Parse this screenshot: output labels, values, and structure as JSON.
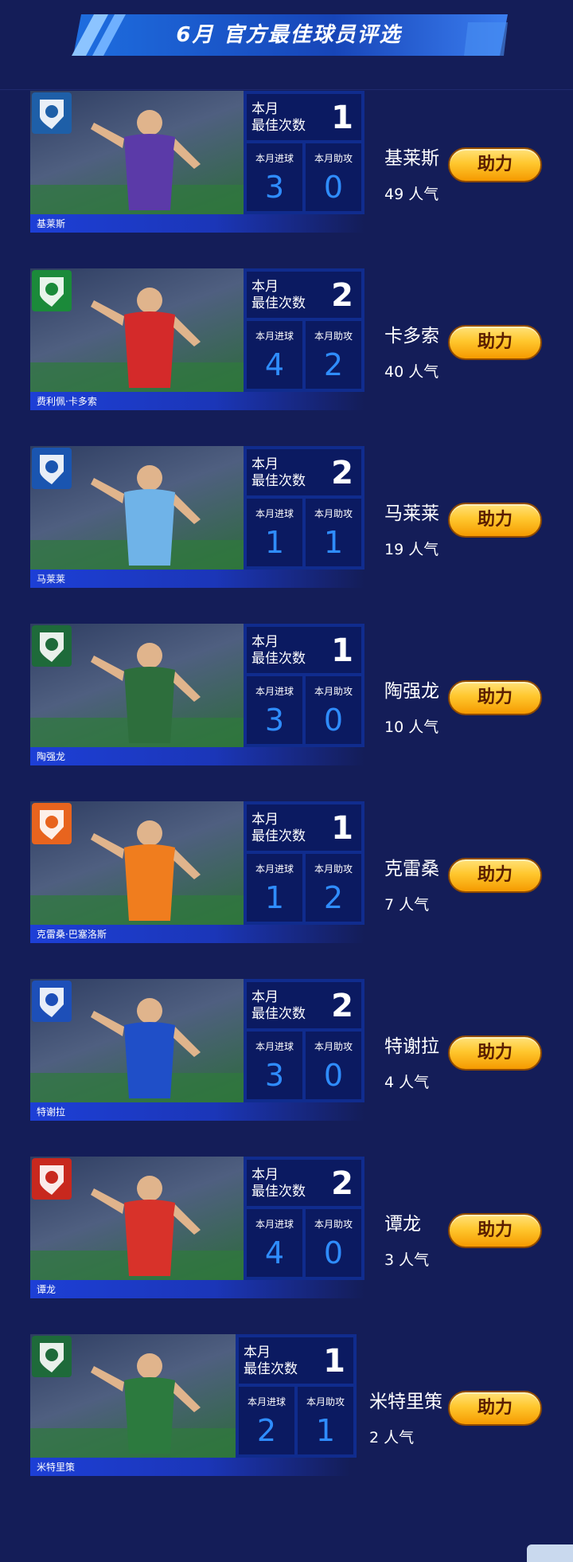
{
  "banner": {
    "title": "6月 官方最佳球员评选"
  },
  "labels": {
    "best_count": "本月\n最佳次数",
    "goals": "本月进球",
    "assists": "本月助攻",
    "boost": "助力"
  },
  "players": [
    {
      "short_name": "基莱斯",
      "full_name": "基莱斯",
      "best_times": "1",
      "goals": "3",
      "assists": "0",
      "popularity": "49 人气",
      "jersey_color": "#5b3aa8",
      "club_badge_color": "#1e5fa8"
    },
    {
      "short_name": "卡多索",
      "full_name": "费利佩·卡多索",
      "best_times": "2",
      "goals": "4",
      "assists": "2",
      "popularity": "40 人气",
      "jersey_color": "#d42a2a",
      "club_badge_color": "#1b8a3a"
    },
    {
      "short_name": "马莱莱",
      "full_name": "马莱莱",
      "best_times": "2",
      "goals": "1",
      "assists": "1",
      "popularity": "19 人气",
      "jersey_color": "#6fb3e8",
      "club_badge_color": "#1a55b0"
    },
    {
      "short_name": "陶强龙",
      "full_name": "陶强龙",
      "best_times": "1",
      "goals": "3",
      "assists": "0",
      "popularity": "10 人气",
      "jersey_color": "#2d6e3c",
      "club_badge_color": "#1e6a3a"
    },
    {
      "short_name": "克雷桑",
      "full_name": "克雷桑·巴塞洛斯",
      "best_times": "1",
      "goals": "1",
      "assists": "2",
      "popularity": "7 人气",
      "jersey_color": "#f07d1e",
      "club_badge_color": "#e8641e"
    },
    {
      "short_name": "特谢拉",
      "full_name": "特谢拉",
      "best_times": "2",
      "goals": "3",
      "assists": "0",
      "popularity": "4 人气",
      "jersey_color": "#1f4fc8",
      "club_badge_color": "#1d4fb8"
    },
    {
      "short_name": "谭龙",
      "full_name": "谭龙",
      "best_times": "2",
      "goals": "4",
      "assists": "0",
      "popularity": "3 人气",
      "jersey_color": "#d8322a",
      "club_badge_color": "#c8281e"
    },
    {
      "short_name": "米特里策",
      "full_name": "米特里策",
      "best_times": "1",
      "goals": "2",
      "assists": "1",
      "popularity": "2 人气",
      "jersey_color": "#2c7a3e",
      "club_badge_color": "#1e6a3a"
    }
  ]
}
